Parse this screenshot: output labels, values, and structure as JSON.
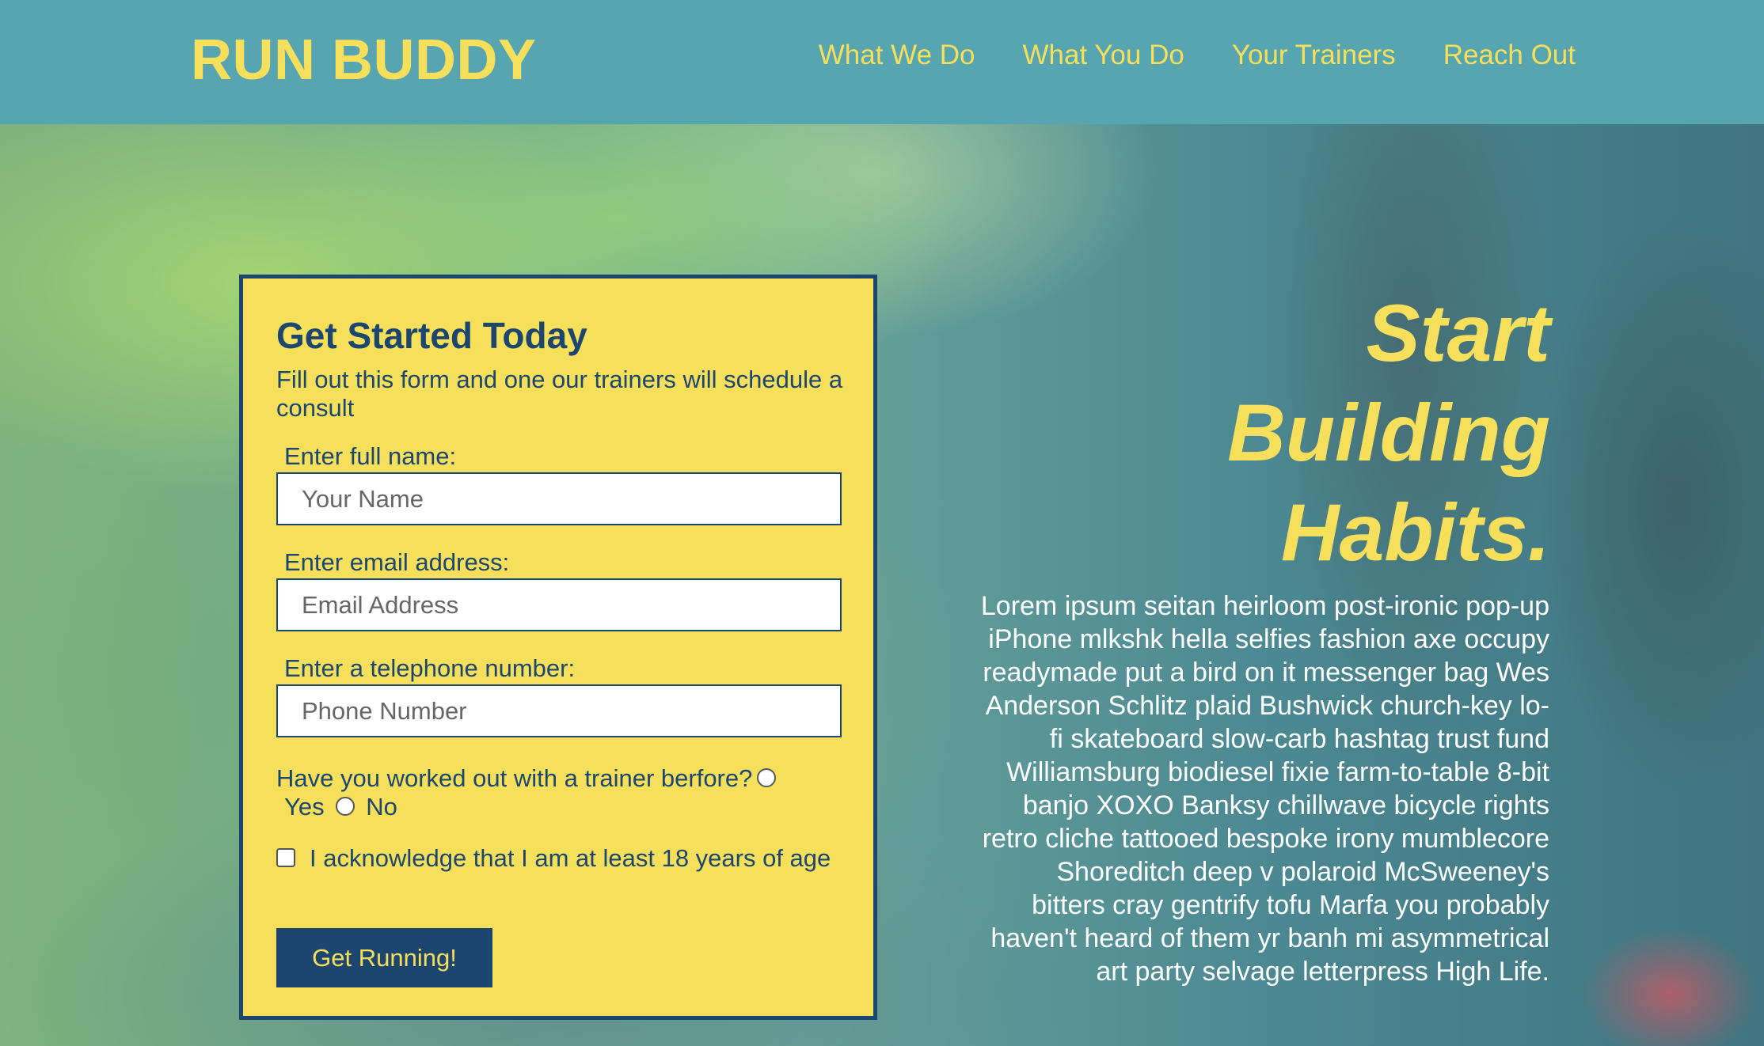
{
  "header": {
    "logo": "RUN BUDDY",
    "nav": [
      "What We Do",
      "What You Do",
      "Your Trainers",
      "Reach Out"
    ]
  },
  "form": {
    "title": "Get Started Today",
    "subtitle": "Fill out this form and one our trainers will schedule a consult",
    "name_label": "Enter full name:",
    "name_placeholder": "Your Name",
    "email_label": "Enter email address:",
    "email_placeholder": "Email Address",
    "phone_label": "Enter a telephone number:",
    "phone_placeholder": "Phone Number",
    "question": "Have you worked out with a trainer berfore?",
    "yes_label": "Yes",
    "no_label": "No",
    "acknowledge": "I acknowledge that I am at least 18 years of age",
    "submit": "Get Running!"
  },
  "hero": {
    "heading_line1": "Start",
    "heading_line2": "Building",
    "heading_line3": "Habits.",
    "body": "Lorem ipsum seitan heirloom post-ironic pop-up iPhone mlkshk hella selfies fashion axe occupy readymade put a bird on it messenger bag Wes Anderson Schlitz plaid Bushwick church-key lo-fi skateboard slow-carb hashtag trust fund Williamsburg biodiesel fixie farm-to-table 8-bit banjo XOXO Banksy chillwave bicycle rights retro cliche tattooed bespoke irony mumblecore Shoreditch deep v polaroid McSweeney's bitters cray gentrify tofu Marfa you probably haven't heard of them yr banh mi asymmetrical art party selvage letterpress High Life."
  },
  "colors": {
    "header_bg": "#58a5b2",
    "accent_yellow": "#f6e05b",
    "navy": "#1c4670"
  }
}
